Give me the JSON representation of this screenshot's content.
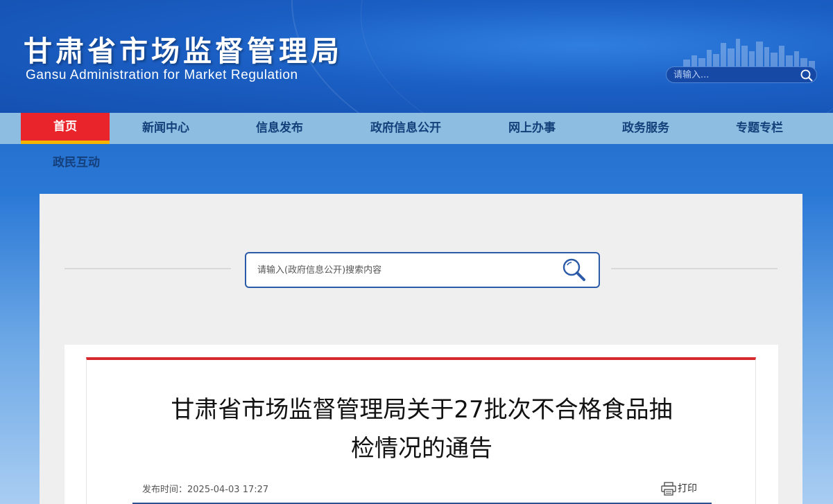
{
  "header": {
    "title_cn": "甘肃省市场监督管理局",
    "title_en": "Gansu Administration for Market Regulation",
    "search_placeholder": "请输入..."
  },
  "nav": {
    "items": [
      {
        "label": "首页",
        "active": true
      },
      {
        "label": "新闻中心"
      },
      {
        "label": "信息发布"
      },
      {
        "label": "政府信息公开"
      },
      {
        "label": "网上办事"
      },
      {
        "label": "政务服务"
      },
      {
        "label": "专题专栏"
      },
      {
        "label": "政民互动"
      }
    ]
  },
  "search": {
    "placeholder": "请输入(政府信息公开)搜索内容"
  },
  "article": {
    "title_line1": "甘肃省市场监督管理局关于27批次不合格食品抽",
    "title_line2": "检情况的通告",
    "publish_label": "发布时间：",
    "publish_time": "2025-04-03 17:27",
    "print_label": "打印"
  },
  "colors": {
    "nav_bg": "#8dbde0",
    "nav_active": "#e9252b",
    "nav_active_underline": "#f4b400",
    "article_accent": "#d62a2f",
    "search_border": "#2b5aa8"
  },
  "icons": [
    "search-icon",
    "city-skyline-icon",
    "print-icon"
  ]
}
